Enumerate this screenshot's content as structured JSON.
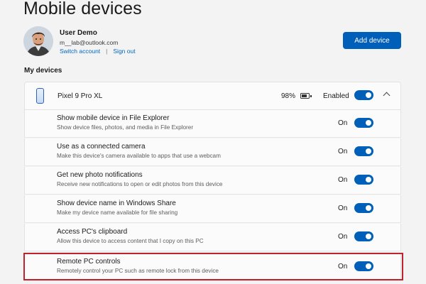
{
  "page": {
    "title": "Mobile devices"
  },
  "account": {
    "name": "User Demo",
    "email": "m__lab@outlook.com",
    "switch_label": "Switch account",
    "separator": "|",
    "signout_label": "Sign out"
  },
  "add_device_label": "Add device",
  "section_label": "My devices",
  "device": {
    "name": "Pixel 9 Pro XL",
    "battery": "98%",
    "enabled_label": "Enabled",
    "enabled": true,
    "expanded": true
  },
  "settings": [
    {
      "title": "Show mobile device in File Explorer",
      "description": "Show device files, photos, and media in File Explorer",
      "state": "On",
      "enabled": true
    },
    {
      "title": "Use as a connected camera",
      "description": "Make this device's camera available to apps that use a webcam",
      "state": "On",
      "enabled": true
    },
    {
      "title": "Get new photo notifications",
      "description": "Receive new notifications to open or edit photos from this device",
      "state": "On",
      "enabled": true
    },
    {
      "title": "Show device name in Windows Share",
      "description": "Make my device name available for file sharing",
      "state": "On",
      "enabled": true
    },
    {
      "title": "Access PC's clipboard",
      "description": "Allow this device to access content that I copy on this PC",
      "state": "On",
      "enabled": true
    },
    {
      "title": "Remote PC controls",
      "description": "Remotely control your PC such as remote lock from this device",
      "state": "On",
      "enabled": true,
      "highlighted": true
    }
  ],
  "colors": {
    "accent": "#005fb8",
    "highlight": "#c0232d",
    "link": "#0067c0"
  },
  "icons": {
    "device": "phone-icon",
    "battery": "battery-icon",
    "collapse": "chevron-up-icon",
    "avatar": "avatar"
  }
}
